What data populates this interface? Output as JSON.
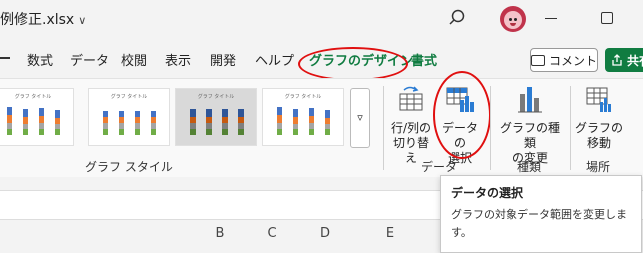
{
  "titlebar": {
    "filename": "例修正.xlsx",
    "filename_chevron": "∨"
  },
  "menu": {
    "items": [
      "数式",
      "データ",
      "校閲",
      "表示",
      "開発",
      "ヘルプ",
      "グラフのデザイン",
      "書式"
    ],
    "comment_label": "コメント",
    "share_label": "共有"
  },
  "ribbon": {
    "chart_styles": {
      "group_label": "グラフ スタイル",
      "thumb_title": "グラフ タイトル",
      "scroll_glyph": "▿"
    },
    "data_group": {
      "label": "データ",
      "switch_row_col": [
        "行/列の",
        "切り替え"
      ],
      "select_data": [
        "データの",
        "選択"
      ]
    },
    "type_group": {
      "label": "種類",
      "change_type": [
        "グラフの種類",
        "の変更"
      ]
    },
    "location_group": {
      "label": "場所",
      "move_chart": [
        "グラフの",
        "移動"
      ]
    }
  },
  "columns": [
    "B",
    "C",
    "D",
    "E",
    "F"
  ],
  "tooltip": {
    "title": "データの選択",
    "body": "グラフの対象データ範囲を変更します。"
  },
  "colors": {
    "accent_green": "#107c41",
    "highlight_red": "#e01010"
  }
}
